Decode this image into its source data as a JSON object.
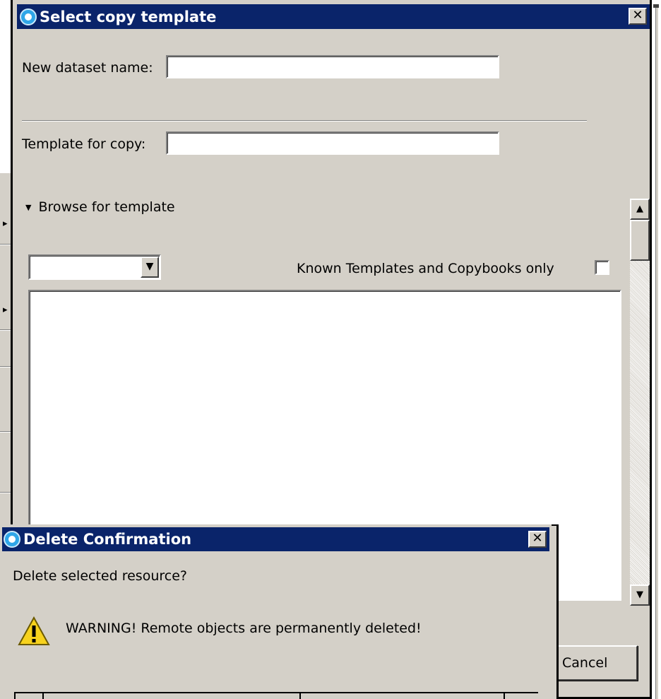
{
  "copy_dialog": {
    "title": "Select copy template",
    "close_glyph": "✕",
    "new_dataset_label": "New dataset name:",
    "new_dataset_value": "",
    "template_label": "Template for copy:",
    "template_value": "",
    "browse_toggle_glyph": "▼",
    "browse_label": "Browse for template",
    "filter_selected": "",
    "known_only_label": "Known Templates and Copybooks only",
    "known_only_checked": false,
    "cancel_label": "Cancel"
  },
  "delete_dialog": {
    "title": "Delete Confirmation",
    "close_glyph": "✕",
    "question": "Delete selected resource?",
    "warning": "WARNING! Remote objects are permanently deleted!"
  },
  "icons": {
    "app_icon": "app-ring-icon",
    "warning_icon": "warning-triangle-icon",
    "dropdown_icon": "chevron-down-icon",
    "scroll_up_icon": "arrow-up-icon",
    "scroll_down_icon": "arrow-down-icon"
  },
  "colors": {
    "titlebar": "#0a246a",
    "dialog_bg": "#d4d0c8",
    "warning_yellow": "#f7d21d"
  }
}
